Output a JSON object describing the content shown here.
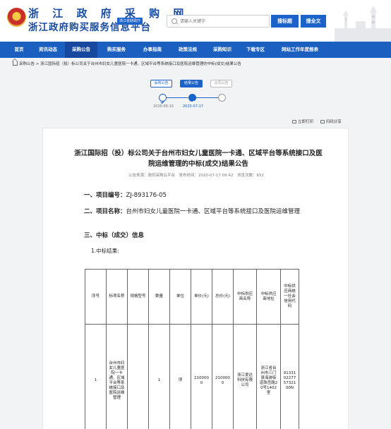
{
  "header": {
    "title_line1": "浙 江 政 府 采 购 网",
    "title_line2": "浙江政府购买服务信息平台",
    "gov_badge": "浙江省财政厅",
    "search_placeholder": "请输入关键字",
    "search_title_button": "搜标题",
    "search_full_button": "搜全文"
  },
  "nav": {
    "items": [
      {
        "label": "首页"
      },
      {
        "label": "资讯动态"
      },
      {
        "label": "采购公告",
        "active": true
      },
      {
        "label": "购买服务"
      },
      {
        "label": "办事指南"
      },
      {
        "label": "政策法规"
      },
      {
        "label": "采购知识"
      },
      {
        "label": "下载专区"
      },
      {
        "label": "网站工作年度报表"
      }
    ]
  },
  "breadcrumb": {
    "text": "采购公告 > 浙江国际招（投）标公司关于台州市妇女儿童医院一卡通、区域平台等系统接口及医院运维管理的中标(成交)结果公告"
  },
  "timeline": {
    "steps": [
      {
        "label": "采购公告",
        "date": "2020-06-15",
        "state": "done"
      },
      {
        "label": "结果公告",
        "date": "2020-07-17",
        "state": "current"
      },
      {
        "label": "合同公告",
        "date": "",
        "state": "todo"
      }
    ],
    "accent": "#1b63c9"
  },
  "tools": {
    "print": "立即打印",
    "share": "扫码分享"
  },
  "article": {
    "title": "浙江国际招（投）标公司关于台州市妇女儿童医院一卡通、区域平台等系统接口及医院运维管理的中标(成交)结果公告",
    "meta": "公告来源：政府采购云平台　发布时间：2020-07-17 09:42　浏览次数：652",
    "section1_label": "一、项目编号：",
    "section1_value": "ZJ-893176-05",
    "section2_label": "二、项目名称：",
    "section2_value": "台州市妇女儿童医院一卡通、区域平台等系统接口及医院运维管理",
    "section3_label": "三、中标（成交）信息",
    "sub1": "1.中标结果:",
    "table": {
      "headers": [
        "序号",
        "标项名称",
        "规格型号",
        "数量",
        "单位",
        "单价(元)",
        "总价(元)",
        "中标供应商名称",
        "中标供应商地址",
        "中标供应商统一社会信用代码"
      ],
      "rows": [
        [
          "1",
          "台州市妇女儿童医院一卡通、区域平台等系统接口及医院运维管理",
          "",
          "1",
          "项",
          "2100000",
          "2100000",
          "浙江爱达科技有限公司",
          "浙江省台州市三门县海游街道珠岙路20号1402室",
          "91331022775732100N"
        ]
      ]
    }
  }
}
